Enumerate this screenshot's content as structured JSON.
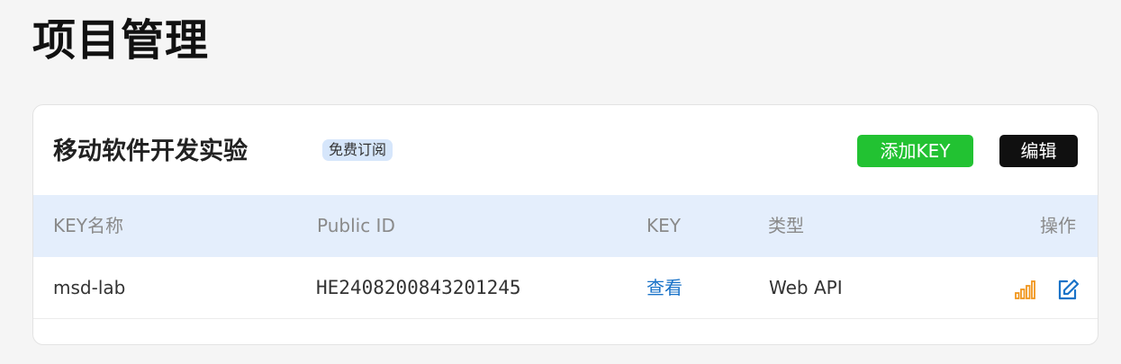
{
  "page": {
    "title": "项目管理"
  },
  "project": {
    "name": "移动软件开发实验",
    "badge": "免费订阅",
    "add_key_label": "添加KEY",
    "edit_label": "编辑"
  },
  "table": {
    "columns": [
      "KEY名称",
      "Public ID",
      "KEY",
      "类型",
      "操作"
    ],
    "rows": [
      {
        "key_name": "msd-lab",
        "public_id": "HE2408200843201245",
        "key_action": "查看",
        "type": "Web API",
        "actions": [
          "bar-chart-icon",
          "edit-icon"
        ]
      }
    ]
  },
  "colors": {
    "accent_green": "#22c232",
    "link_blue": "#1a73c8",
    "header_bg": "#e4eefc",
    "stats_orange": "#f0961e"
  }
}
